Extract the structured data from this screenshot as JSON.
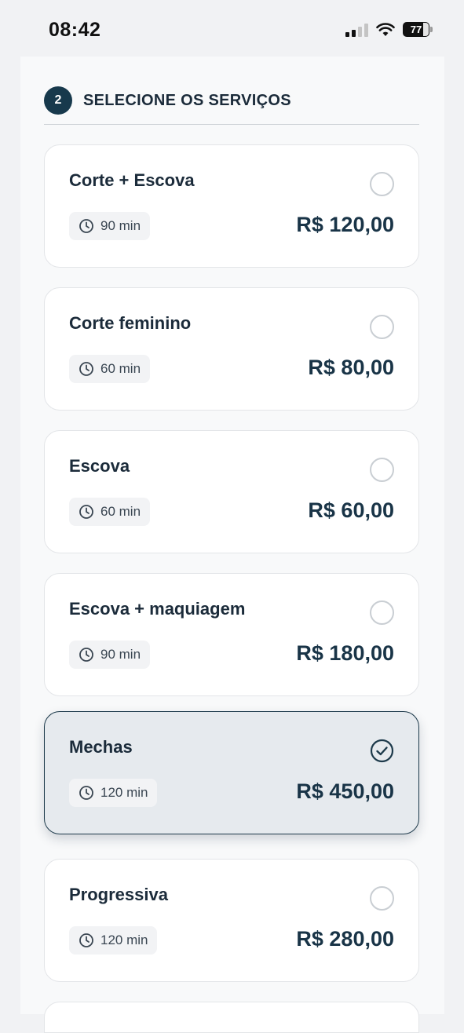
{
  "status_bar": {
    "time": "08:42",
    "battery": "77"
  },
  "step": {
    "number": "2",
    "title": "SELECIONE OS SERVIÇOS"
  },
  "colors": {
    "accent": "#17394c",
    "selected_bg": "#e6eaee"
  },
  "services": [
    {
      "name": "Corte + Escova",
      "duration": "90 min",
      "price": "R$ 120,00",
      "selected": false
    },
    {
      "name": "Corte feminino",
      "duration": "60 min",
      "price": "R$ 80,00",
      "selected": false
    },
    {
      "name": "Escova",
      "duration": "60 min",
      "price": "R$ 60,00",
      "selected": false
    },
    {
      "name": "Escova + maquiagem",
      "duration": "90 min",
      "price": "R$ 180,00",
      "selected": false
    },
    {
      "name": "Mechas",
      "duration": "120 min",
      "price": "R$ 450,00",
      "selected": true
    },
    {
      "name": "Progressiva",
      "duration": "120 min",
      "price": "R$ 280,00",
      "selected": false
    }
  ]
}
